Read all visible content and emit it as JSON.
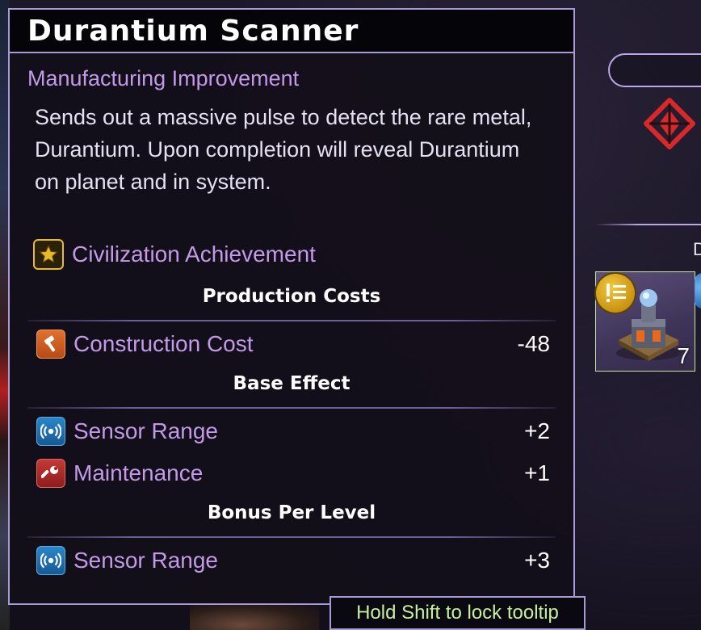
{
  "tooltip": {
    "title": "Durantium Scanner",
    "category": "Manufacturing Improvement",
    "description": "Sends out a massive pulse to detect the rare metal, Durantium. Upon completion will reveal Durantium on planet and in system.",
    "achievement": {
      "label": "Civilization Achievement",
      "icon": "star-icon"
    },
    "sections": {
      "production_costs": {
        "header": "Production Costs",
        "rows": [
          {
            "label": "Construction Cost",
            "value": "-48",
            "icon": "hammer-icon"
          }
        ]
      },
      "base_effect": {
        "header": "Base Effect",
        "rows": [
          {
            "label": "Sensor Range",
            "value": "+2",
            "icon": "sensor-icon"
          },
          {
            "label": "Maintenance",
            "value": "+1",
            "icon": "wrench-icon"
          }
        ]
      },
      "bonus_per_level": {
        "header": "Bonus Per Level",
        "rows": [
          {
            "label": "Sensor Range",
            "value": "+3",
            "icon": "sensor-icon"
          }
        ]
      }
    },
    "hint": "Hold Shift to lock tooltip"
  },
  "right_panel": {
    "partial_letter": "D",
    "building_card": {
      "count": "7",
      "badge_icon": "alert-list-icon"
    }
  },
  "colors": {
    "accent_purple": "#c39ae8",
    "border": "#a99bd6",
    "hint_green": "#c7f09b",
    "faction_red": "#d8282a"
  }
}
